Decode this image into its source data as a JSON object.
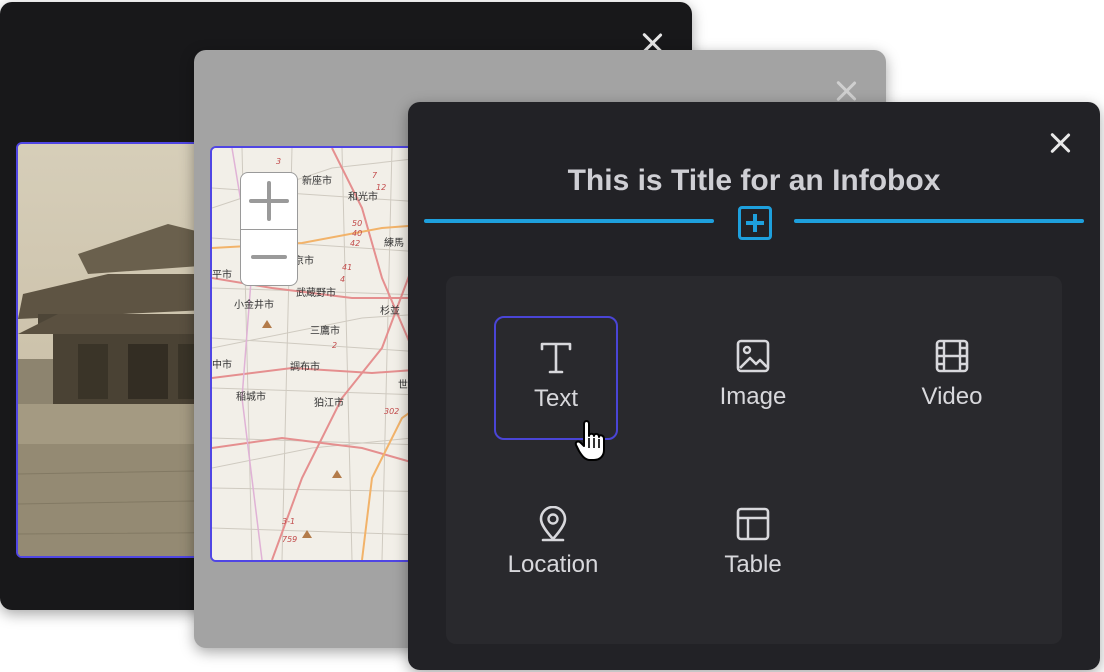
{
  "infobox": {
    "title": "This is Title for an Infobox",
    "options": [
      {
        "label": "Text",
        "icon": "text-icon",
        "selected": true
      },
      {
        "label": "Image",
        "icon": "image-icon",
        "selected": false
      },
      {
        "label": "Video",
        "icon": "video-icon",
        "selected": false
      },
      {
        "label": "Location",
        "icon": "location-pin-icon",
        "selected": false
      },
      {
        "label": "Table",
        "icon": "table-icon",
        "selected": false
      }
    ]
  },
  "map_labels": [
    "新座市",
    "和光市",
    "練馬",
    "東京市",
    "武蔵野市",
    "小金井市",
    "杉並",
    "三鷹市",
    "調布市",
    "稲城市",
    "狛江市",
    "世",
    "平市",
    "中市"
  ],
  "map_route_numbers": [
    "50",
    "40",
    "42",
    "41",
    "4",
    "7",
    "12",
    "2",
    "302",
    "3",
    "759",
    "3-1"
  ],
  "colors": {
    "accent": "#1ea0dd",
    "selection": "#4a45d6",
    "panel_dark": "#222226",
    "panel_gray": "#a3a3a3",
    "panel_black": "#18181a"
  }
}
